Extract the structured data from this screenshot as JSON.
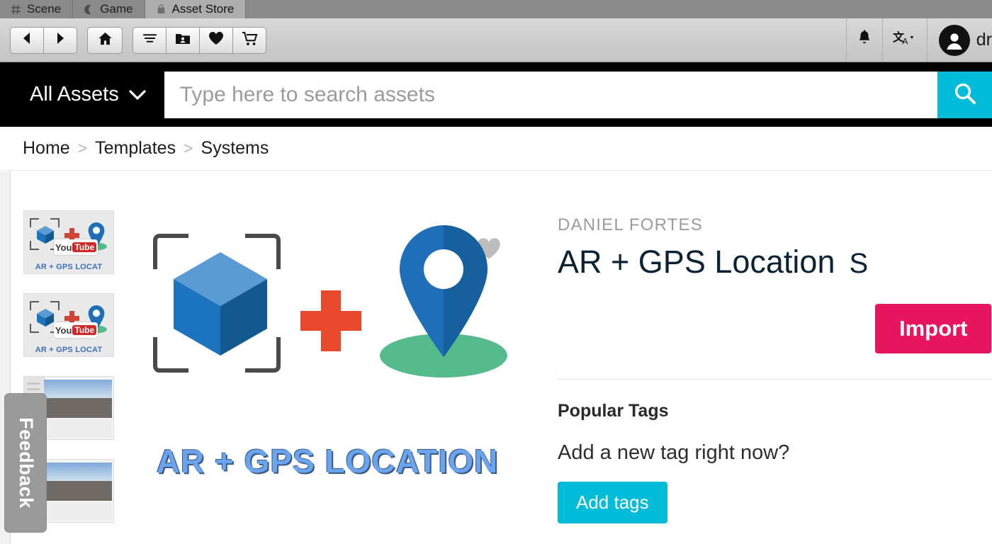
{
  "editor": {
    "tabs": [
      {
        "label": "Scene",
        "icon": "grid-icon",
        "active": false
      },
      {
        "label": "Game",
        "icon": "game-icon",
        "active": false
      },
      {
        "label": "Asset Store",
        "icon": "shopping-bag-icon",
        "active": true
      }
    ],
    "toolbar": {
      "back": "back-arrow-icon",
      "forward": "forward-arrow-icon",
      "home": "home-icon",
      "filter": "filter-icon",
      "my_assets": "my-assets-folder-icon",
      "favorites": "heart-icon",
      "cart": "shopping-cart-icon",
      "notifications": "bell-icon",
      "language": "translate-icon",
      "username": "dr"
    }
  },
  "search": {
    "category_label": "All Assets",
    "placeholder": "Type here to search assets",
    "value": "",
    "button_icon": "search-icon"
  },
  "breadcrumb": {
    "items": [
      "Home",
      "Templates",
      "Systems"
    ],
    "separator": ">"
  },
  "gallery": {
    "thumbnails": [
      {
        "type": "artwork",
        "caption": "AR + GPS LOCAT",
        "badge": "youtube",
        "badge_text_1": "You",
        "badge_text_2": "Tube"
      },
      {
        "type": "artwork",
        "caption": "AR + GPS LOCAT",
        "badge": "youtube",
        "badge_text_1": "You",
        "badge_text_2": "Tube"
      },
      {
        "type": "screenshot",
        "caption": "",
        "badge": "",
        "badge_text_1": "",
        "badge_text_2": ""
      },
      {
        "type": "screenshot",
        "caption": "",
        "badge": "",
        "badge_text_1": "",
        "badge_text_2": ""
      }
    ]
  },
  "hero": {
    "title": "AR + GPS LOCATION",
    "favorite_icon": "heart-icon",
    "favorited": false
  },
  "asset": {
    "publisher": "DANIEL FORTES",
    "title": "AR + GPS Location",
    "price": "S",
    "import_label": "Import",
    "second_action_label": ""
  },
  "tags": {
    "heading": "Popular Tags",
    "question": "Add a new tag right now?",
    "add_label": "Add tags"
  },
  "feedback": {
    "label": "Feedback"
  },
  "colors": {
    "accent_cyan": "#00bcd9",
    "accent_pink": "#e8155e",
    "title_navy": "#0b2233",
    "hero_blue": "#6ba4ee",
    "plus_red": "#e8492b",
    "pin_blue": "#1e6fb8",
    "ground_green": "#55bb8c"
  }
}
